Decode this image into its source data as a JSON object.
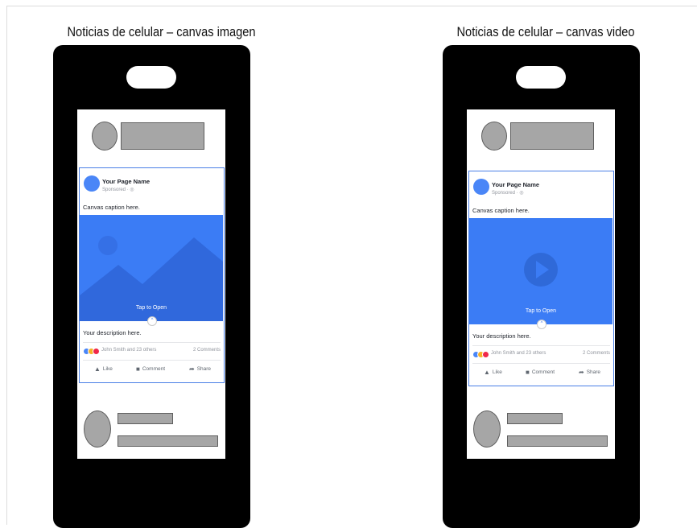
{
  "mockups": [
    {
      "title": "Noticias de celular – canvas imagen",
      "media_type": "image",
      "ad": {
        "page_name": "Your Page Name",
        "sponsored": "Sponsored · ◎",
        "caption": "Canvas caption here.",
        "tap_label": "Tap to Open",
        "description": "Your description here.",
        "reaction_names": "John Smith and 23 others",
        "comments": "2 Comments",
        "actions": {
          "like": "Like",
          "comment": "Comment",
          "share": "Share"
        }
      }
    },
    {
      "title": "Noticias de celular – canvas video",
      "media_type": "video",
      "ad": {
        "page_name": "Your Page Name",
        "sponsored": "Sponsored · ◎",
        "caption": "Canvas caption here.",
        "tap_label": "Tap to Open",
        "description": "Your description here.",
        "reaction_names": "John Smith and 23 others",
        "comments": "2 Comments",
        "actions": {
          "like": "Like",
          "comment": "Comment",
          "share": "Share"
        }
      }
    }
  ],
  "icons": {
    "tap_handle": "chevron-up-icon",
    "like": "thumbs-up-icon",
    "comment": "comment-icon",
    "share": "share-arrow-icon",
    "media_image": "image-placeholder-icon",
    "media_video": "play-icon"
  },
  "colors": {
    "phone": "#000000",
    "media_blue": "#3b7cf5",
    "ad_border": "#4a7fe6",
    "placeholder": "#a6a6a6"
  }
}
